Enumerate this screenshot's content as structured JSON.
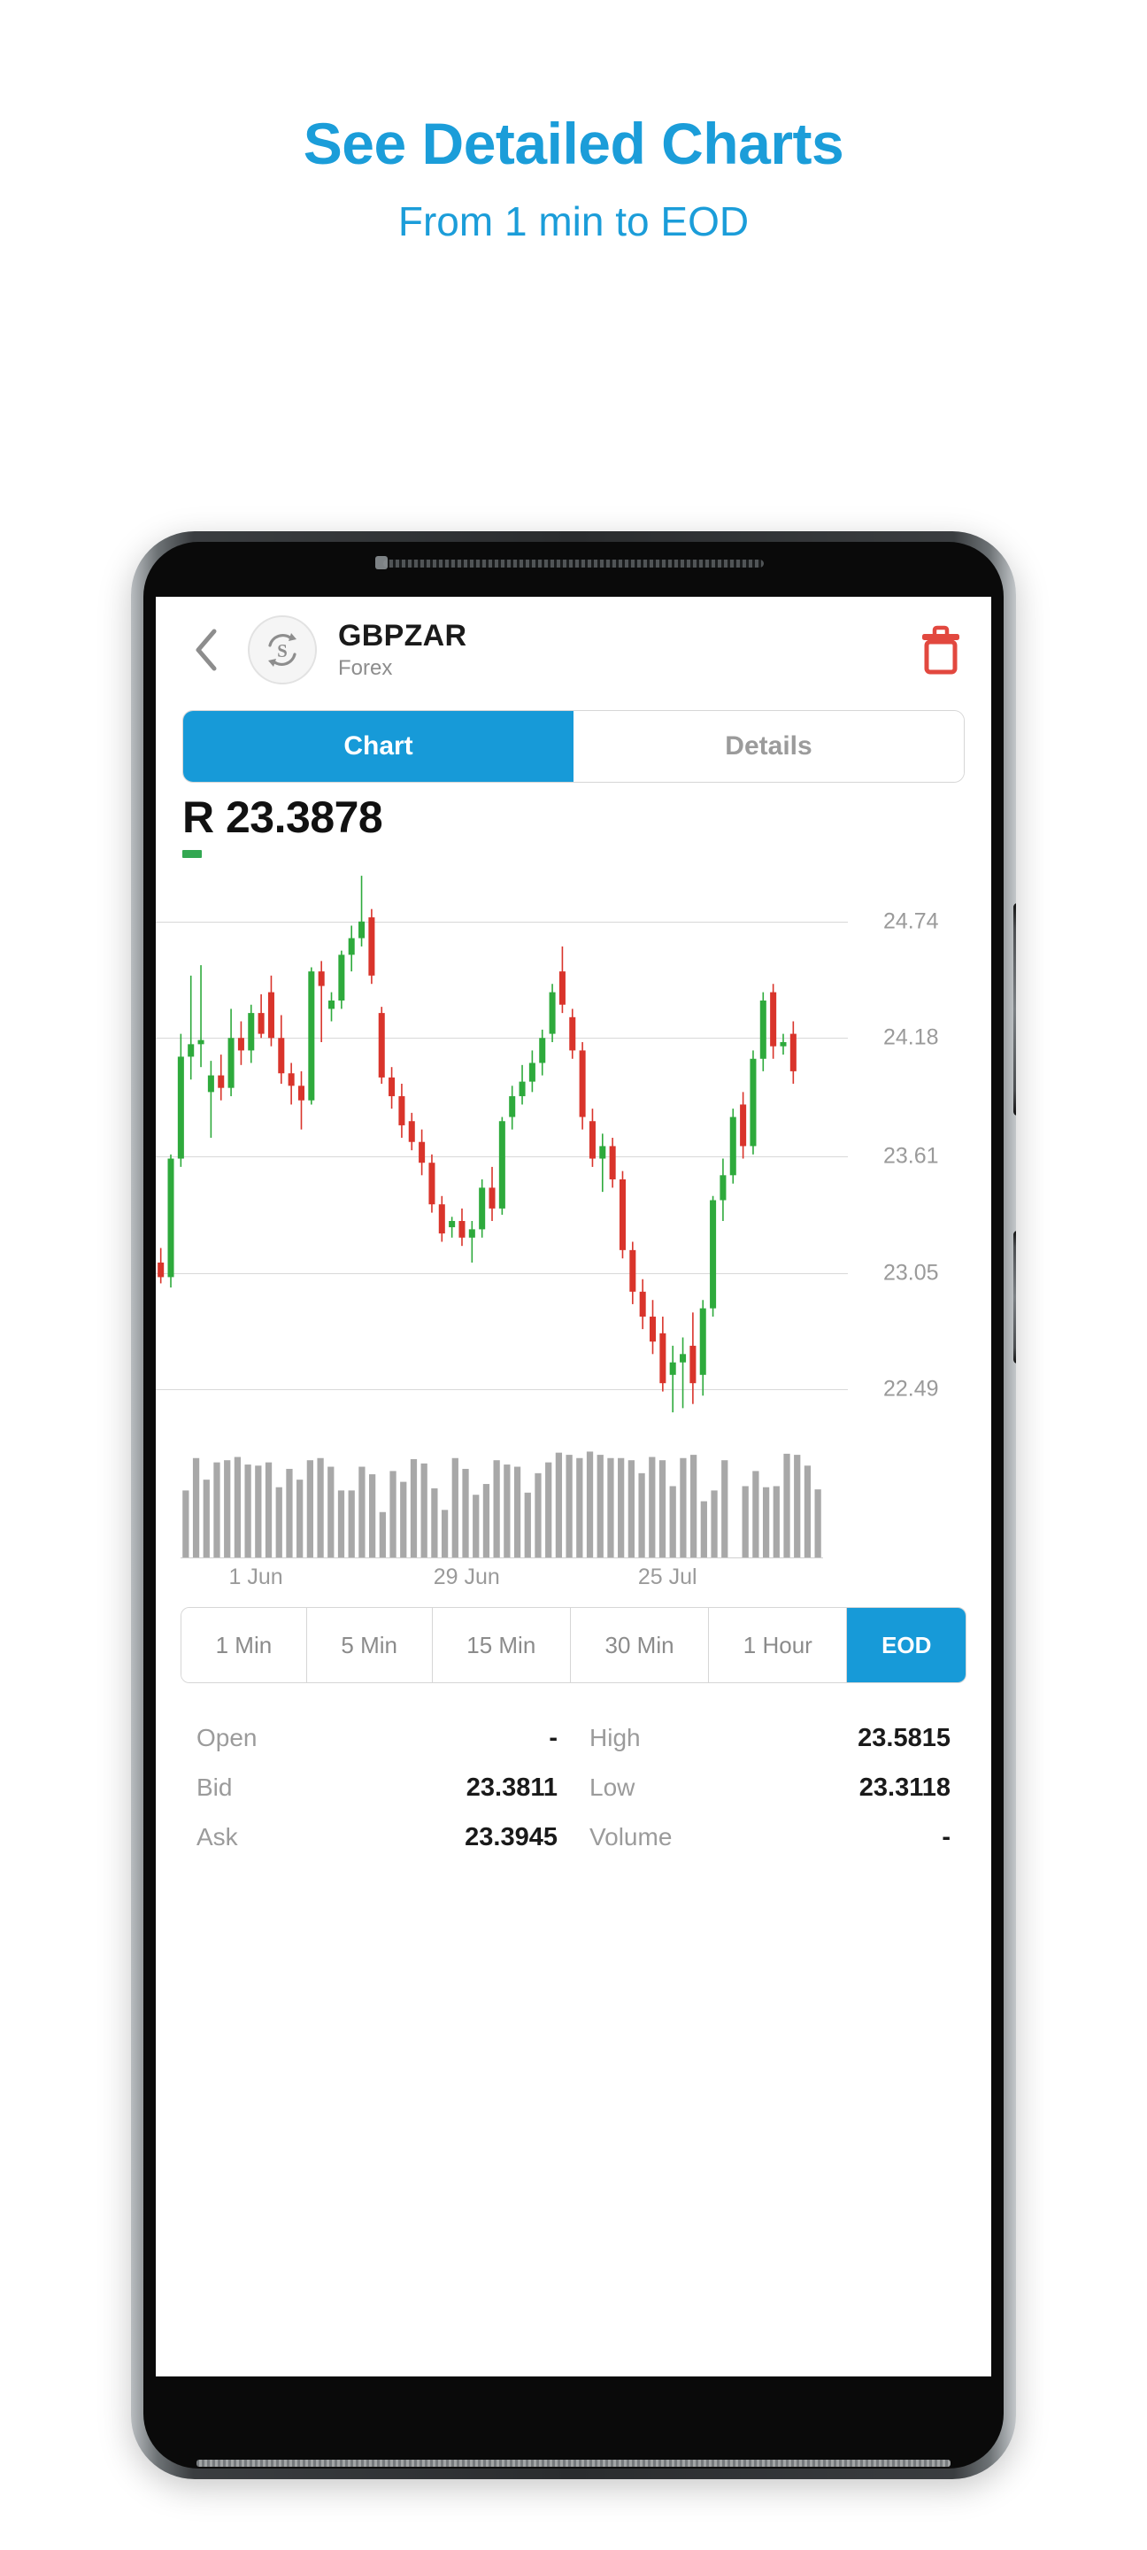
{
  "promo": {
    "title": "See Detailed Charts",
    "subtitle": "From 1 min to EOD",
    "accent_color": "#1b9dd9"
  },
  "app": {
    "header": {
      "back_icon": "chevron-left-icon",
      "symbol_icon": "currency-exchange-icon",
      "symbol": "GBPZAR",
      "asset_class": "Forex",
      "delete_icon": "trash-icon",
      "delete_color": "#e2483f"
    },
    "tabs": [
      {
        "label": "Chart",
        "active": true
      },
      {
        "label": "Details",
        "active": false
      }
    ],
    "quote": {
      "price": "R 23.3878",
      "change_indicator_color": "#33a852"
    },
    "timeframes": [
      {
        "label": "1 Min",
        "active": false
      },
      {
        "label": "5 Min",
        "active": false
      },
      {
        "label": "15 Min",
        "active": false
      },
      {
        "label": "30 Min",
        "active": false
      },
      {
        "label": "1 Hour",
        "active": false
      },
      {
        "label": "EOD",
        "active": true
      }
    ],
    "stats": [
      [
        {
          "label": "Open",
          "value": "-"
        },
        {
          "label": "High",
          "value": "23.5815"
        }
      ],
      [
        {
          "label": "Bid",
          "value": "23.3811"
        },
        {
          "label": "Low",
          "value": "23.3118"
        }
      ],
      [
        {
          "label": "Ask",
          "value": "23.3945"
        },
        {
          "label": "Volume",
          "value": "-"
        }
      ]
    ]
  },
  "chart_data": {
    "type": "candlestick",
    "title": "GBPZAR",
    "xlabel": "",
    "ylabel": "",
    "grid": true,
    "legend": "none",
    "up_color": "#2eaa3c",
    "down_color": "#d9342b",
    "volume_color": "#a8a8a8",
    "ylim": [
      22.21,
      25.02
    ],
    "yticks": [
      24.74,
      24.18,
      23.61,
      23.05,
      22.49
    ],
    "xticks": [
      {
        "label": "1 Jun",
        "index": 7
      },
      {
        "label": "29 Jun",
        "index": 28
      },
      {
        "label": "25 Jul",
        "index": 48
      }
    ],
    "ohlc": [
      {
        "o": 23.1,
        "h": 23.17,
        "l": 23.0,
        "c": 23.03
      },
      {
        "o": 23.03,
        "h": 23.62,
        "l": 22.98,
        "c": 23.6
      },
      {
        "o": 23.6,
        "h": 24.2,
        "l": 23.56,
        "c": 24.09
      },
      {
        "o": 24.09,
        "h": 24.48,
        "l": 23.98,
        "c": 24.15
      },
      {
        "o": 24.15,
        "h": 24.53,
        "l": 24.04,
        "c": 24.17
      },
      {
        "o": 23.92,
        "h": 24.07,
        "l": 23.7,
        "c": 24.0
      },
      {
        "o": 24.0,
        "h": 24.1,
        "l": 23.88,
        "c": 23.94
      },
      {
        "o": 23.94,
        "h": 24.32,
        "l": 23.9,
        "c": 24.18
      },
      {
        "o": 24.18,
        "h": 24.26,
        "l": 24.05,
        "c": 24.12
      },
      {
        "o": 24.12,
        "h": 24.34,
        "l": 24.06,
        "c": 24.3
      },
      {
        "o": 24.3,
        "h": 24.39,
        "l": 24.18,
        "c": 24.2
      },
      {
        "o": 24.4,
        "h": 24.48,
        "l": 24.14,
        "c": 24.18
      },
      {
        "o": 24.18,
        "h": 24.29,
        "l": 23.96,
        "c": 24.01
      },
      {
        "o": 24.01,
        "h": 24.06,
        "l": 23.86,
        "c": 23.95
      },
      {
        "o": 23.95,
        "h": 24.02,
        "l": 23.74,
        "c": 23.88
      },
      {
        "o": 23.88,
        "h": 24.52,
        "l": 23.86,
        "c": 24.5
      },
      {
        "o": 24.5,
        "h": 24.55,
        "l": 24.16,
        "c": 24.43
      },
      {
        "o": 24.32,
        "h": 24.4,
        "l": 24.26,
        "c": 24.36
      },
      {
        "o": 24.36,
        "h": 24.6,
        "l": 24.32,
        "c": 24.58
      },
      {
        "o": 24.58,
        "h": 24.72,
        "l": 24.5,
        "c": 24.66
      },
      {
        "o": 24.66,
        "h": 24.96,
        "l": 24.62,
        "c": 24.74
      },
      {
        "o": 24.76,
        "h": 24.8,
        "l": 24.44,
        "c": 24.48
      },
      {
        "o": 24.3,
        "h": 24.33,
        "l": 23.96,
        "c": 23.99
      },
      {
        "o": 23.99,
        "h": 24.04,
        "l": 23.84,
        "c": 23.9
      },
      {
        "o": 23.9,
        "h": 23.96,
        "l": 23.7,
        "c": 23.76
      },
      {
        "o": 23.78,
        "h": 23.82,
        "l": 23.64,
        "c": 23.68
      },
      {
        "o": 23.68,
        "h": 23.74,
        "l": 23.52,
        "c": 23.58
      },
      {
        "o": 23.58,
        "h": 23.62,
        "l": 23.34,
        "c": 23.38
      },
      {
        "o": 23.38,
        "h": 23.42,
        "l": 23.2,
        "c": 23.24
      },
      {
        "o": 23.27,
        "h": 23.32,
        "l": 23.22,
        "c": 23.3
      },
      {
        "o": 23.3,
        "h": 23.36,
        "l": 23.18,
        "c": 23.22
      },
      {
        "o": 23.22,
        "h": 23.3,
        "l": 23.1,
        "c": 23.26
      },
      {
        "o": 23.26,
        "h": 23.5,
        "l": 23.22,
        "c": 23.46
      },
      {
        "o": 23.46,
        "h": 23.56,
        "l": 23.3,
        "c": 23.36
      },
      {
        "o": 23.36,
        "h": 23.8,
        "l": 23.33,
        "c": 23.78
      },
      {
        "o": 23.8,
        "h": 23.95,
        "l": 23.74,
        "c": 23.9
      },
      {
        "o": 23.9,
        "h": 24.05,
        "l": 23.86,
        "c": 23.97
      },
      {
        "o": 23.97,
        "h": 24.12,
        "l": 23.92,
        "c": 24.06
      },
      {
        "o": 24.06,
        "h": 24.22,
        "l": 24.0,
        "c": 24.18
      },
      {
        "o": 24.2,
        "h": 24.44,
        "l": 24.16,
        "c": 24.4
      },
      {
        "o": 24.5,
        "h": 24.62,
        "l": 24.3,
        "c": 24.34
      },
      {
        "o": 24.28,
        "h": 24.32,
        "l": 24.08,
        "c": 24.12
      },
      {
        "o": 24.12,
        "h": 24.16,
        "l": 23.74,
        "c": 23.8
      },
      {
        "o": 23.78,
        "h": 23.84,
        "l": 23.56,
        "c": 23.6
      },
      {
        "o": 23.6,
        "h": 23.72,
        "l": 23.44,
        "c": 23.66
      },
      {
        "o": 23.66,
        "h": 23.7,
        "l": 23.46,
        "c": 23.5
      },
      {
        "o": 23.5,
        "h": 23.54,
        "l": 23.12,
        "c": 23.16
      },
      {
        "o": 23.16,
        "h": 23.2,
        "l": 22.9,
        "c": 22.96
      },
      {
        "o": 22.96,
        "h": 23.02,
        "l": 22.78,
        "c": 22.84
      },
      {
        "o": 22.84,
        "h": 22.92,
        "l": 22.66,
        "c": 22.72
      },
      {
        "o": 22.76,
        "h": 22.84,
        "l": 22.48,
        "c": 22.52
      },
      {
        "o": 22.56,
        "h": 22.7,
        "l": 22.38,
        "c": 22.62
      },
      {
        "o": 22.62,
        "h": 22.74,
        "l": 22.4,
        "c": 22.66
      },
      {
        "o": 22.7,
        "h": 22.86,
        "l": 22.42,
        "c": 22.52
      },
      {
        "o": 22.56,
        "h": 22.92,
        "l": 22.46,
        "c": 22.88
      },
      {
        "o": 22.88,
        "h": 23.42,
        "l": 22.84,
        "c": 23.4
      },
      {
        "o": 23.4,
        "h": 23.6,
        "l": 23.3,
        "c": 23.52
      },
      {
        "o": 23.52,
        "h": 23.84,
        "l": 23.48,
        "c": 23.8
      },
      {
        "o": 23.86,
        "h": 23.92,
        "l": 23.6,
        "c": 23.66
      },
      {
        "o": 23.66,
        "h": 24.12,
        "l": 23.62,
        "c": 24.08
      },
      {
        "o": 24.08,
        "h": 24.4,
        "l": 24.02,
        "c": 24.36
      },
      {
        "o": 24.4,
        "h": 24.44,
        "l": 24.08,
        "c": 24.14
      },
      {
        "o": 24.14,
        "h": 24.2,
        "l": 24.1,
        "c": 24.16
      },
      {
        "o": 24.2,
        "h": 24.26,
        "l": 23.96,
        "c": 24.02
      }
    ],
    "volume": [
      0.62,
      0.92,
      0.72,
      0.88,
      0.9,
      0.93,
      0.86,
      0.85,
      0.88,
      0.65,
      0.82,
      0.72,
      0.9,
      0.92,
      0.84,
      0.62,
      0.62,
      0.84,
      0.77,
      0.42,
      0.8,
      0.7,
      0.91,
      0.87,
      0.64,
      0.44,
      0.92,
      0.82,
      0.58,
      0.68,
      0.9,
      0.86,
      0.84,
      0.6,
      0.78,
      0.88,
      0.97,
      0.95,
      0.92,
      0.98,
      0.95,
      0.92,
      0.92,
      0.9,
      0.78,
      0.93,
      0.9,
      0.66,
      0.92,
      0.95,
      0.52,
      0.62,
      0.9,
      0.0,
      0.66,
      0.8,
      0.65,
      0.66,
      0.96,
      0.95,
      0.85,
      0.63
    ]
  }
}
